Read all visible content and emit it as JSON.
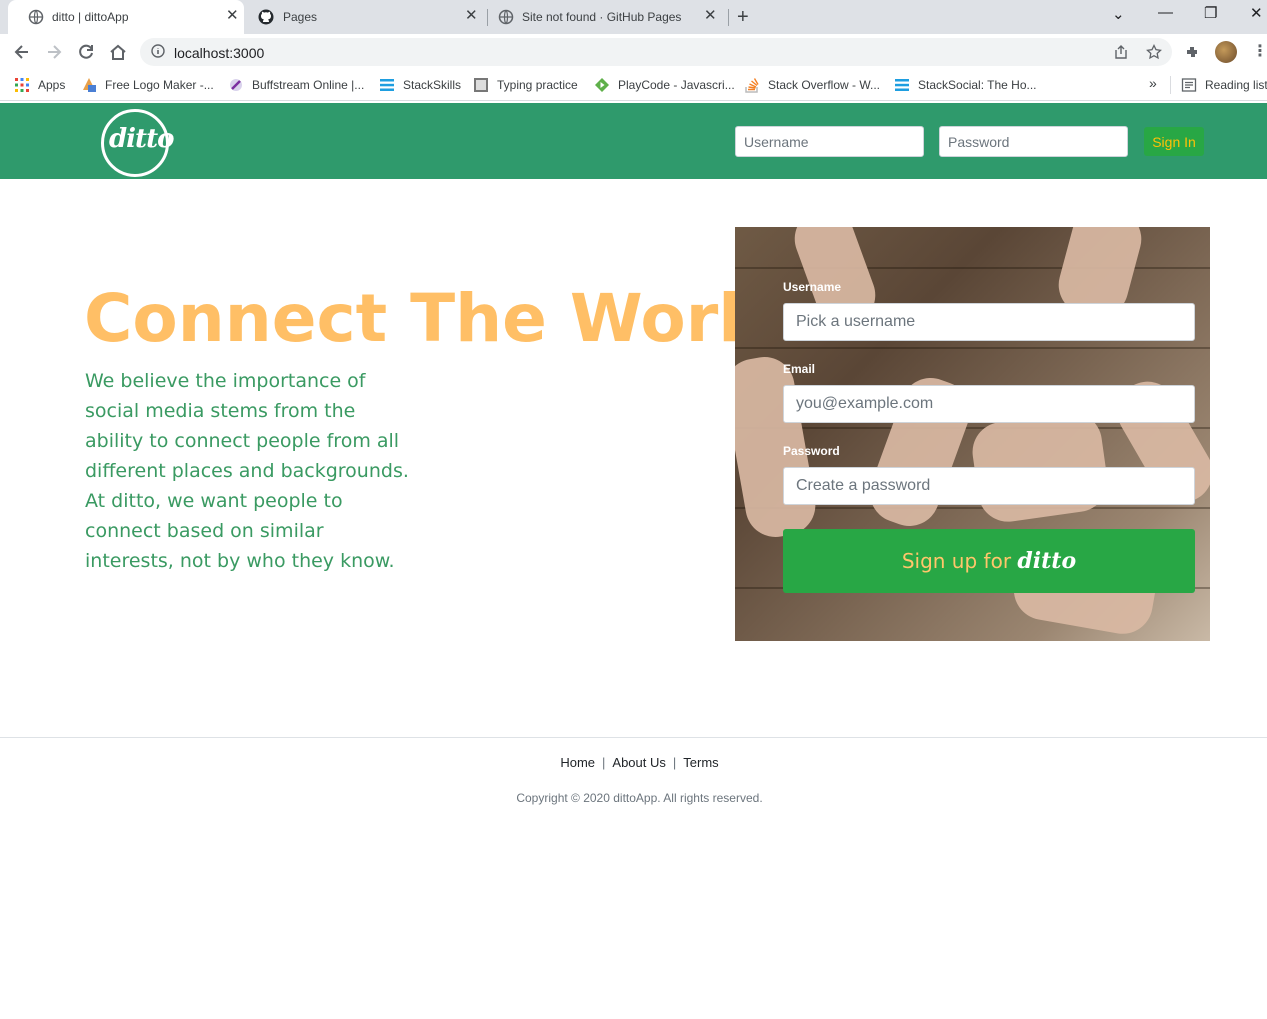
{
  "browser": {
    "tabs": [
      {
        "title": "ditto | dittoApp",
        "active": true,
        "icon": "globe-icon"
      },
      {
        "title": "Pages",
        "active": false,
        "icon": "github-icon"
      },
      {
        "title": "Site not found · GitHub Pages",
        "active": false,
        "icon": "globe-icon"
      }
    ],
    "url": "localhost:3000",
    "bookmarks": [
      {
        "label": "Apps",
        "icon": "apps-grid-icon"
      },
      {
        "label": "Free Logo Maker -...",
        "icon": "logo-maker-icon"
      },
      {
        "label": "Buffstream Online |...",
        "icon": "buffstream-icon"
      },
      {
        "label": "StackSkills",
        "icon": "stackskills-icon"
      },
      {
        "label": "Typing practice",
        "icon": "typing-icon"
      },
      {
        "label": "PlayCode - Javascri...",
        "icon": "playcode-icon"
      },
      {
        "label": "Stack Overflow - W...",
        "icon": "stackoverflow-icon"
      },
      {
        "label": "StackSocial: The Ho...",
        "icon": "stacksocial-icon"
      }
    ],
    "overflow_label": "»",
    "reading_list": "Reading list"
  },
  "header": {
    "logo_text": "ditto",
    "username_placeholder": "Username",
    "password_placeholder": "Password",
    "signin_label": "Sign In"
  },
  "hero": {
    "title": "Connect The World",
    "body": "We believe the importance of social media stems from the ability to connect people from all different places and backgrounds. At ditto, we want people to connect based on similar interests, not by who they know."
  },
  "signup": {
    "username_label": "Username",
    "username_placeholder": "Pick a username",
    "email_label": "Email",
    "email_placeholder": "you@example.com",
    "password_label": "Password",
    "password_placeholder": "Create a password",
    "button_prefix": "Sign up for",
    "button_brand": "ditto"
  },
  "footer": {
    "links": [
      "Home",
      "About Us",
      "Terms"
    ],
    "copyright": "Copyright © 2020 dittoApp. All rights reserved."
  },
  "colors": {
    "header_green": "#2f9a6c",
    "button_green": "#28a745",
    "title_orange": "#ffbf66",
    "text_green": "#3a9a62"
  }
}
